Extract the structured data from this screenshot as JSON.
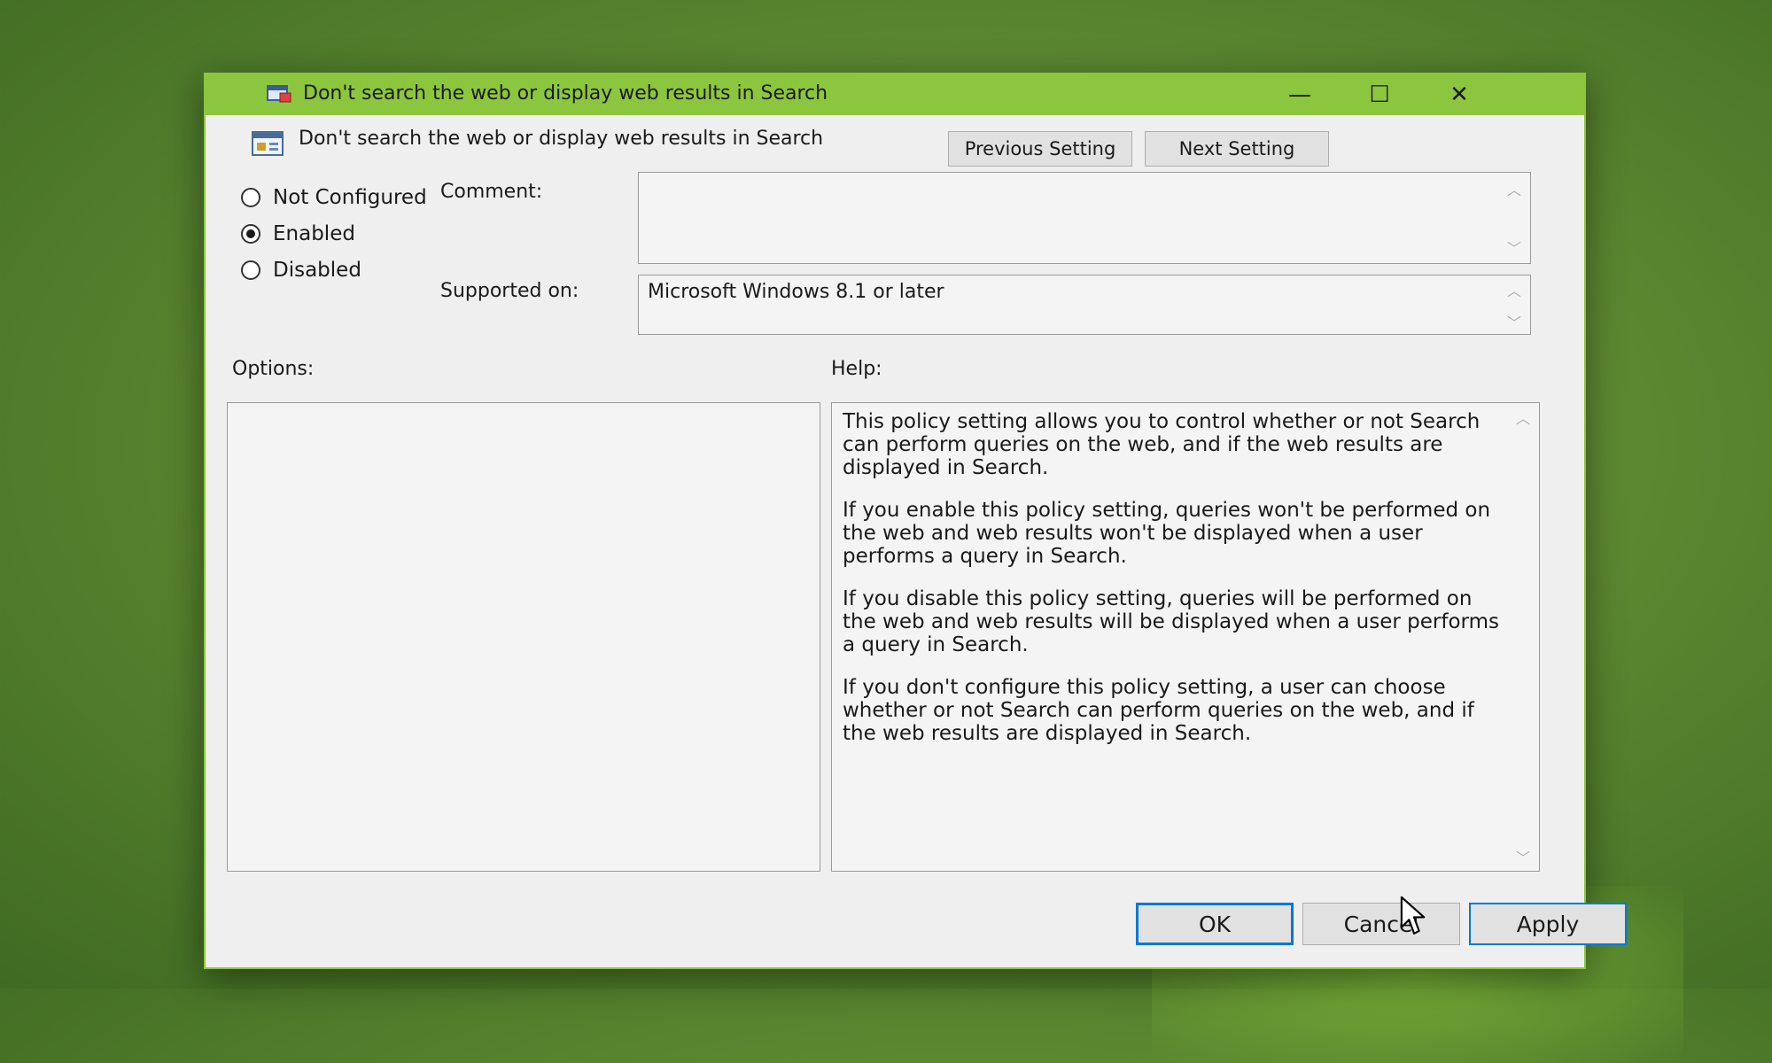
{
  "window": {
    "title": "Don't search the web or display web results in Search",
    "minimize_glyph": "—",
    "maximize_glyph": "☐",
    "close_glyph": "✕",
    "accent_color": "#8cc63f"
  },
  "policy": {
    "name": "Don't search the web or display web results in Search",
    "previous_label": "Previous Setting",
    "next_label": "Next Setting"
  },
  "state": {
    "options": [
      {
        "label": "Not Configured",
        "checked": false
      },
      {
        "label": "Enabled",
        "checked": true
      },
      {
        "label": "Disabled",
        "checked": false
      }
    ]
  },
  "comment": {
    "label": "Comment:",
    "value": ""
  },
  "supported": {
    "label": "Supported on:",
    "value": "Microsoft Windows 8.1 or later"
  },
  "options_label": "Options:",
  "help": {
    "label": "Help:",
    "paragraphs": [
      "This policy setting allows you to control whether or not Search can perform queries on the web, and if the web results are displayed in Search.",
      "If you enable this policy setting, queries won't be performed on the web and web results won't be displayed when a user performs a query in Search.",
      "If you disable this policy setting, queries will be performed on the web and web results will be displayed when a user performs a query in Search.",
      "If you don't configure this policy setting, a user can choose whether or not Search can perform queries on the web, and if the web results are displayed in Search."
    ]
  },
  "footer": {
    "ok_label": "OK",
    "cancel_label": "Cancel",
    "apply_label": "Apply"
  },
  "icons": {
    "app": "group-policy-icon",
    "policy": "policy-setting-icon",
    "cursor": "mouse-pointer-icon"
  }
}
